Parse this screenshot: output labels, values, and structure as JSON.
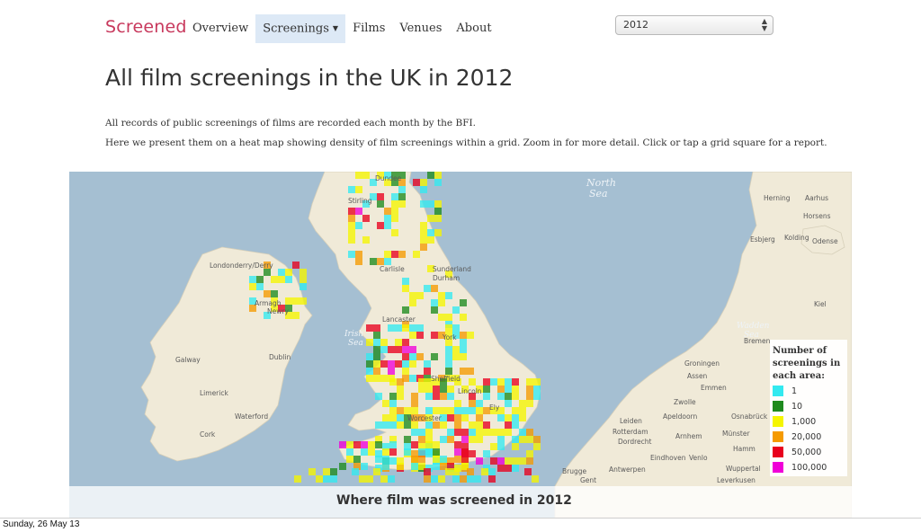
{
  "brand": "Screened",
  "nav": {
    "overview": "Overview",
    "screenings": "Screenings",
    "films": "Films",
    "venues": "Venues",
    "about": "About"
  },
  "year_select": {
    "value": "2012"
  },
  "title": "All film screenings in the UK in 2012",
  "description": [
    "All records of public screenings of films are recorded each month by the BFI.",
    "Here we present them on a heat map showing density of film screenings within a grid.  Zoom in for more detail.  Click or tap a grid square for a report."
  ],
  "map": {
    "sea_labels": [
      "North",
      "Sea",
      "Irish",
      "Sea",
      "Wadden",
      "Sea"
    ],
    "places": {
      "dundee": "Dundee",
      "stirling": "Stirling",
      "herning": "Herning",
      "aarhus": "Aarhus",
      "horsens": "Horsens",
      "kolding": "Kolding",
      "esbjerg": "Esbjerg",
      "odense": "Odense",
      "londonderry": "Londonderry/Derry",
      "armagh": "Armagh",
      "newry": "Newry",
      "carlisle": "Carlisle",
      "sunderland": "Sunderland",
      "durham": "Durham",
      "kiel": "Kiel",
      "lancaster": "Lancaster",
      "york": "York",
      "galway": "Galway",
      "dublin": "Dublin",
      "limerick": "Limerick",
      "waterford": "Waterford",
      "cork": "Cork",
      "bremen": "Bremen",
      "groningen": "Groningen",
      "assen": "Assen",
      "emmen": "Emmen",
      "zwolle": "Zwolle",
      "leiden": "Leiden",
      "apeldoorn": "Apeldoorn",
      "osnabruck": "Osnabrück",
      "rotterdam": "Rotterdam",
      "dordrecht": "Dordrecht",
      "arnhem": "Arnhem",
      "munster": "Münster",
      "hamm": "Hamm",
      "brugge": "Brugge",
      "antwerpen": "Antwerpen",
      "eindhoven": "Eindhoven",
      "venlo": "Venlo",
      "wuppertal": "Wuppertal",
      "gent": "Gent",
      "leverkusen": "Leverkusen",
      "ely": "Ely",
      "worcester": "Worcester",
      "sheffield": "Sheffield",
      "lincoln": "Lincoln"
    },
    "caption": "Where film was screened in 2012"
  },
  "legend": {
    "title": "Number of\nscreenings in\neach area:",
    "items": [
      {
        "label": "1",
        "color": "#33e9f0"
      },
      {
        "label": "10",
        "color": "#1e8a1e"
      },
      {
        "label": "1,000",
        "color": "#f5f500"
      },
      {
        "label": "20,000",
        "color": "#f59a00"
      },
      {
        "label": "50,000",
        "color": "#e8001e"
      },
      {
        "label": "100,000",
        "color": "#f000d8"
      }
    ]
  },
  "colors": {
    "brand": "#c8395d",
    "nav_active": "#dde9f6",
    "sea": "#a5bfd2",
    "land": "#f0ead8"
  },
  "footer": {
    "date": "Sunday, 26 May 13"
  }
}
